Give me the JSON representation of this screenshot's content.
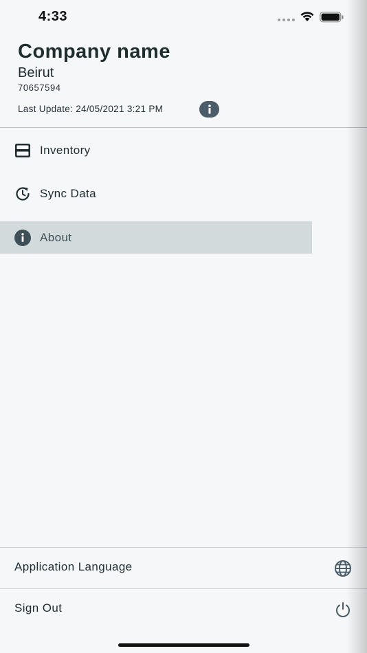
{
  "status_bar": {
    "time": "4:33"
  },
  "header": {
    "company_name": "Company name",
    "city": "Beirut",
    "phone": "70657594",
    "last_update": "Last Update: 24/05/2021 3:21 PM"
  },
  "menu": {
    "items": [
      {
        "label": "Inventory",
        "icon": "inventory-tray-icon"
      },
      {
        "label": "Sync Data",
        "icon": "sync-clock-icon"
      },
      {
        "label": "About",
        "icon": "info-icon",
        "active": true
      }
    ]
  },
  "footer": {
    "language_label": "Application Language",
    "language_icon": "globe-icon",
    "signout_label": "Sign Out",
    "signout_icon": "power-icon"
  },
  "colors": {
    "background": "#f5f7f8",
    "active_item": "#d3dadc",
    "icon": "#4a5d68",
    "text": "#1f2d33"
  }
}
